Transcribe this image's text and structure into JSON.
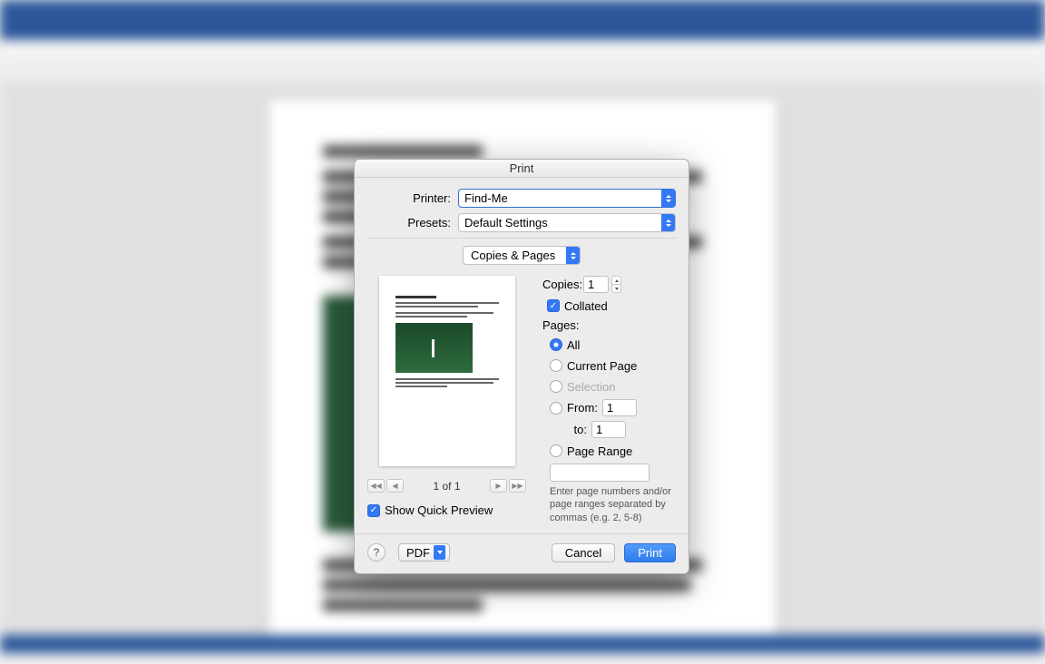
{
  "dialog": {
    "title": "Print",
    "printer_label": "Printer:",
    "printer_value": "Find-Me",
    "presets_label": "Presets:",
    "presets_value": "Default Settings",
    "section_value": "Copies & Pages",
    "copies_label": "Copies:",
    "copies_value": "1",
    "collated_label": "Collated",
    "pages_heading": "Pages:",
    "radio_all": "All",
    "radio_current": "Current Page",
    "radio_selection": "Selection",
    "radio_from": "From:",
    "from_value": "1",
    "to_label": "to:",
    "to_value": "1",
    "radio_pagerange": "Page Range",
    "helper": "Enter page numbers and/or page ranges separated by commas (e.g. 2, 5-8)",
    "page_counter": "1 of 1",
    "show_preview": "Show Quick Preview",
    "help_symbol": "?",
    "pdf_label": "PDF",
    "cancel_label": "Cancel",
    "print_label": "Print"
  }
}
